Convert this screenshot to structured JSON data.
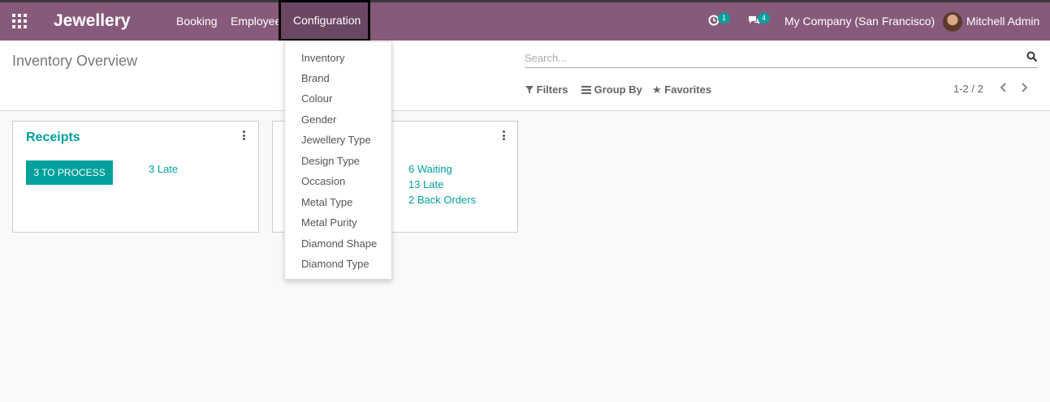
{
  "app": {
    "brand": "Jewellery"
  },
  "menu": {
    "booking": "Booking",
    "employee": "Employee",
    "configuration": "Configuration"
  },
  "systray": {
    "activity_count": "1",
    "messages_count": "4",
    "company": "My Company (San Francisco)",
    "user": "Mitchell Admin"
  },
  "control_panel": {
    "title": "Inventory Overview",
    "search_placeholder": "Search...",
    "filters": "Filters",
    "group_by": "Group By",
    "favorites": "Favorites",
    "pager": "1-2 / 2"
  },
  "cards": {
    "receipts": {
      "title": "Receipts",
      "process_button": "3 TO PROCESS",
      "late": "3 Late"
    },
    "second": {
      "waiting": "6 Waiting",
      "late": "13 Late",
      "back_orders": "2 Back Orders"
    }
  },
  "config_dropdown": {
    "items": [
      "Inventory",
      "Brand",
      "Colour",
      "Gender",
      "Jewellery Type",
      "Design Type",
      "Occasion",
      "Metal Type",
      "Metal Purity",
      "Diamond Shape",
      "Diamond Type"
    ]
  },
  "colors": {
    "topbar": "#875a7b",
    "accent": "#00a09d"
  }
}
